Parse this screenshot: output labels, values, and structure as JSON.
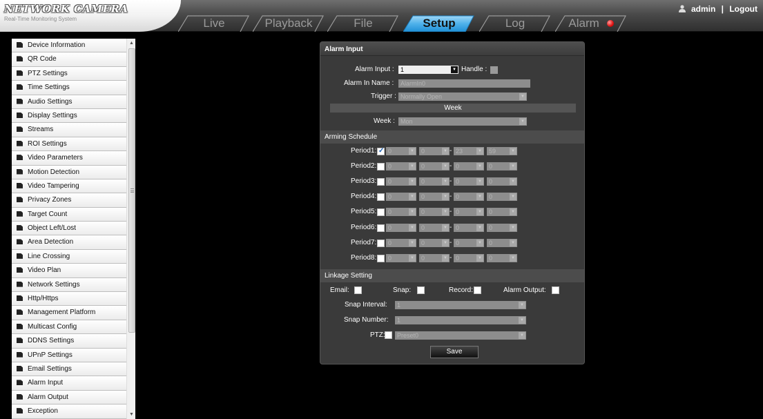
{
  "app": {
    "title": "NETWORK CAMERA",
    "subtitle": "Real-Time Monitoring System"
  },
  "nav": {
    "tabs": [
      {
        "label": "Live"
      },
      {
        "label": "Playback"
      },
      {
        "label": "File"
      },
      {
        "label": "Setup"
      },
      {
        "label": "Log"
      },
      {
        "label": "Alarm"
      }
    ],
    "active_tab": "Setup"
  },
  "user": {
    "name": "admin",
    "separator": "|",
    "logout": "Logout"
  },
  "sidebar": {
    "items": [
      {
        "label": "Device Information"
      },
      {
        "label": "QR Code"
      },
      {
        "label": "PTZ Settings"
      },
      {
        "label": "Time Settings"
      },
      {
        "label": "Audio Settings"
      },
      {
        "label": "Display Settings"
      },
      {
        "label": "Streams"
      },
      {
        "label": "ROI Settings"
      },
      {
        "label": "Video Parameters"
      },
      {
        "label": "Motion Detection"
      },
      {
        "label": "Video Tampering"
      },
      {
        "label": "Privacy Zones"
      },
      {
        "label": "Target Count"
      },
      {
        "label": "Object Left/Lost"
      },
      {
        "label": "Area Detection"
      },
      {
        "label": "Line Crossing"
      },
      {
        "label": "Video Plan"
      },
      {
        "label": "Network Settings"
      },
      {
        "label": "Http/Https"
      },
      {
        "label": "Management Platform"
      },
      {
        "label": "Multicast Config"
      },
      {
        "label": "DDNS Settings"
      },
      {
        "label": "UPnP Settings"
      },
      {
        "label": "Email Settings"
      },
      {
        "label": "Alarm Input"
      },
      {
        "label": "Alarm Output"
      },
      {
        "label": "Exception"
      }
    ]
  },
  "panel": {
    "title": "Alarm Input",
    "alarm_input_label": "Alarm Input :",
    "alarm_input_value": "1",
    "handle_label": "Handle :",
    "alarm_in_name_label": "Alarm In Name :",
    "alarm_in_name_value": "AlarmIn0",
    "trigger_label": "Trigger :",
    "trigger_value": "Normally Open",
    "week_header": "Week",
    "week_label": "Week :",
    "week_value": "Mon",
    "arming_schedule": "Arming Schedule",
    "periods": [
      {
        "label": "Period1:",
        "checked": true,
        "start_h": "0",
        "start_m": "0",
        "end_h": "23",
        "end_m": "59"
      },
      {
        "label": "Period2:",
        "checked": false,
        "start_h": "0",
        "start_m": "0",
        "end_h": "0",
        "end_m": "0"
      },
      {
        "label": "Period3:",
        "checked": false,
        "start_h": "0",
        "start_m": "0",
        "end_h": "0",
        "end_m": "0"
      },
      {
        "label": "Period4:",
        "checked": false,
        "start_h": "0",
        "start_m": "0",
        "end_h": "0",
        "end_m": "0"
      },
      {
        "label": "Period5:",
        "checked": false,
        "start_h": "0",
        "start_m": "0",
        "end_h": "0",
        "end_m": "0"
      },
      {
        "label": "Period6:",
        "checked": false,
        "start_h": "0",
        "start_m": "0",
        "end_h": "0",
        "end_m": "0"
      },
      {
        "label": "Period7:",
        "checked": false,
        "start_h": "0",
        "start_m": "0",
        "end_h": "0",
        "end_m": "0"
      },
      {
        "label": "Period8:",
        "checked": false,
        "start_h": "0",
        "start_m": "0",
        "end_h": "0",
        "end_m": "0"
      }
    ],
    "dash": "-",
    "linkage_setting": "Linkage Setting",
    "email_label": "Email:",
    "snap_label": "Snap:",
    "record_label": "Record:",
    "alarm_output_label": "Alarm Output:",
    "snap_interval_label": "Snap Interval:",
    "snap_interval_value": "1",
    "snap_number_label": "Snap Number:",
    "snap_number_value": "1",
    "ptz_label": "PTZ:",
    "ptz_value": "Preset0",
    "save_label": "Save"
  },
  "colors": {
    "background": "#000000",
    "panel": "#3a3a3a",
    "alarm_indicator": "#e01010"
  }
}
